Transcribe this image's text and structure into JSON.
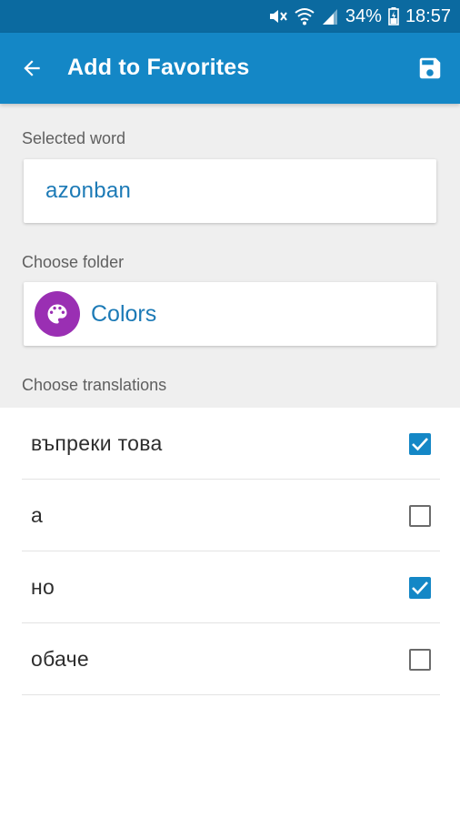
{
  "status_bar": {
    "battery_percent": "34%",
    "time": "18:57",
    "icons": [
      "mute-icon",
      "wifi-icon",
      "signal-icon",
      "battery-icon"
    ]
  },
  "app_bar": {
    "title": "Add to Favorites",
    "back_icon": "arrow-back-icon",
    "save_icon": "save-icon"
  },
  "form": {
    "selected_word_label": "Selected word",
    "selected_word": "azonban",
    "choose_folder_label": "Choose folder",
    "folder_name": "Colors",
    "folder_icon": "palette-icon",
    "folder_color": "#9a2fb3",
    "choose_translations_label": "Choose translations"
  },
  "translations": [
    {
      "text": "въпреки това",
      "checked": true
    },
    {
      "text": "а",
      "checked": false
    },
    {
      "text": "но",
      "checked": true
    },
    {
      "text": "обаче",
      "checked": false
    }
  ],
  "colors": {
    "status_bar": "#0b6aa0",
    "app_bar": "#1487c6",
    "accent": "#1c7ab6"
  }
}
